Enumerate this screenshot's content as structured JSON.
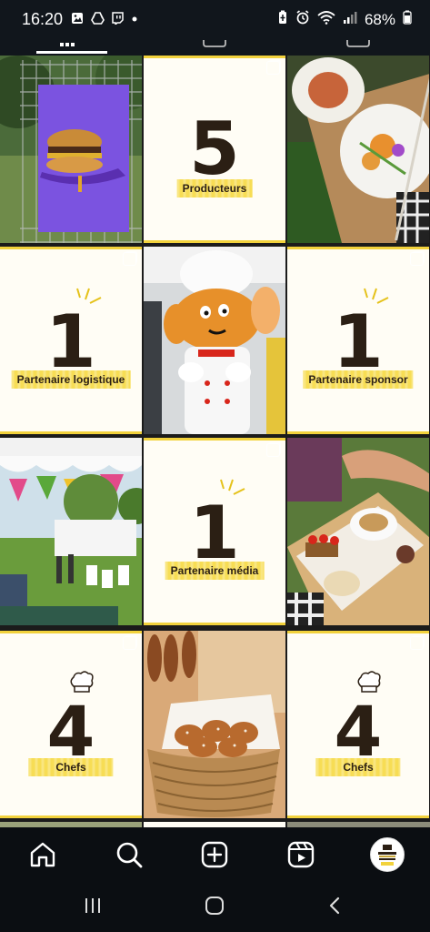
{
  "status": {
    "time": "16:20",
    "battery": "68%",
    "notification_icons": [
      "gallery-icon",
      "drive-icon",
      "twitch-icon",
      "dot-icon"
    ],
    "system_icons": [
      "battery-saver-icon",
      "alarm-icon",
      "wifi-icon",
      "signal-icon",
      "battery-icon"
    ]
  },
  "tiles": [
    {
      "kind": "photo",
      "name": "burger-poster-photo"
    },
    {
      "kind": "stat",
      "number": "5",
      "label": "Producteurs",
      "chef_hat": false,
      "rays": false
    },
    {
      "kind": "photo",
      "name": "plated-dish-photo"
    },
    {
      "kind": "stat",
      "number": "1",
      "label": "Partenaire logistique",
      "chef_hat": false,
      "rays": true
    },
    {
      "kind": "photo",
      "name": "chef-mascot-photo"
    },
    {
      "kind": "stat",
      "number": "1",
      "label": "Partenaire sponsor",
      "chef_hat": false,
      "rays": true
    },
    {
      "kind": "photo",
      "name": "festival-tents-photo"
    },
    {
      "kind": "stat",
      "number": "1",
      "label": "Partenaire média",
      "chef_hat": false,
      "rays": true
    },
    {
      "kind": "photo",
      "name": "dessert-tray-photo"
    },
    {
      "kind": "stat",
      "number": "4",
      "label": "Chefs",
      "chef_hat": true,
      "rays": false
    },
    {
      "kind": "photo",
      "name": "pretzel-basket-photo"
    },
    {
      "kind": "stat",
      "number": "4",
      "label": "Chefs",
      "chef_hat": true,
      "rays": false
    }
  ],
  "colors": {
    "accent_yellow": "#f7dd55",
    "number_brown": "#2b1f14",
    "tile_bg": "#fffdf5",
    "nav_bg": "#0b0e12"
  },
  "bottom_nav": [
    "home-icon",
    "search-icon",
    "create-icon",
    "reels-icon",
    "profile-avatar"
  ],
  "system_nav": [
    "recents-icon",
    "home-button-icon",
    "back-icon"
  ]
}
